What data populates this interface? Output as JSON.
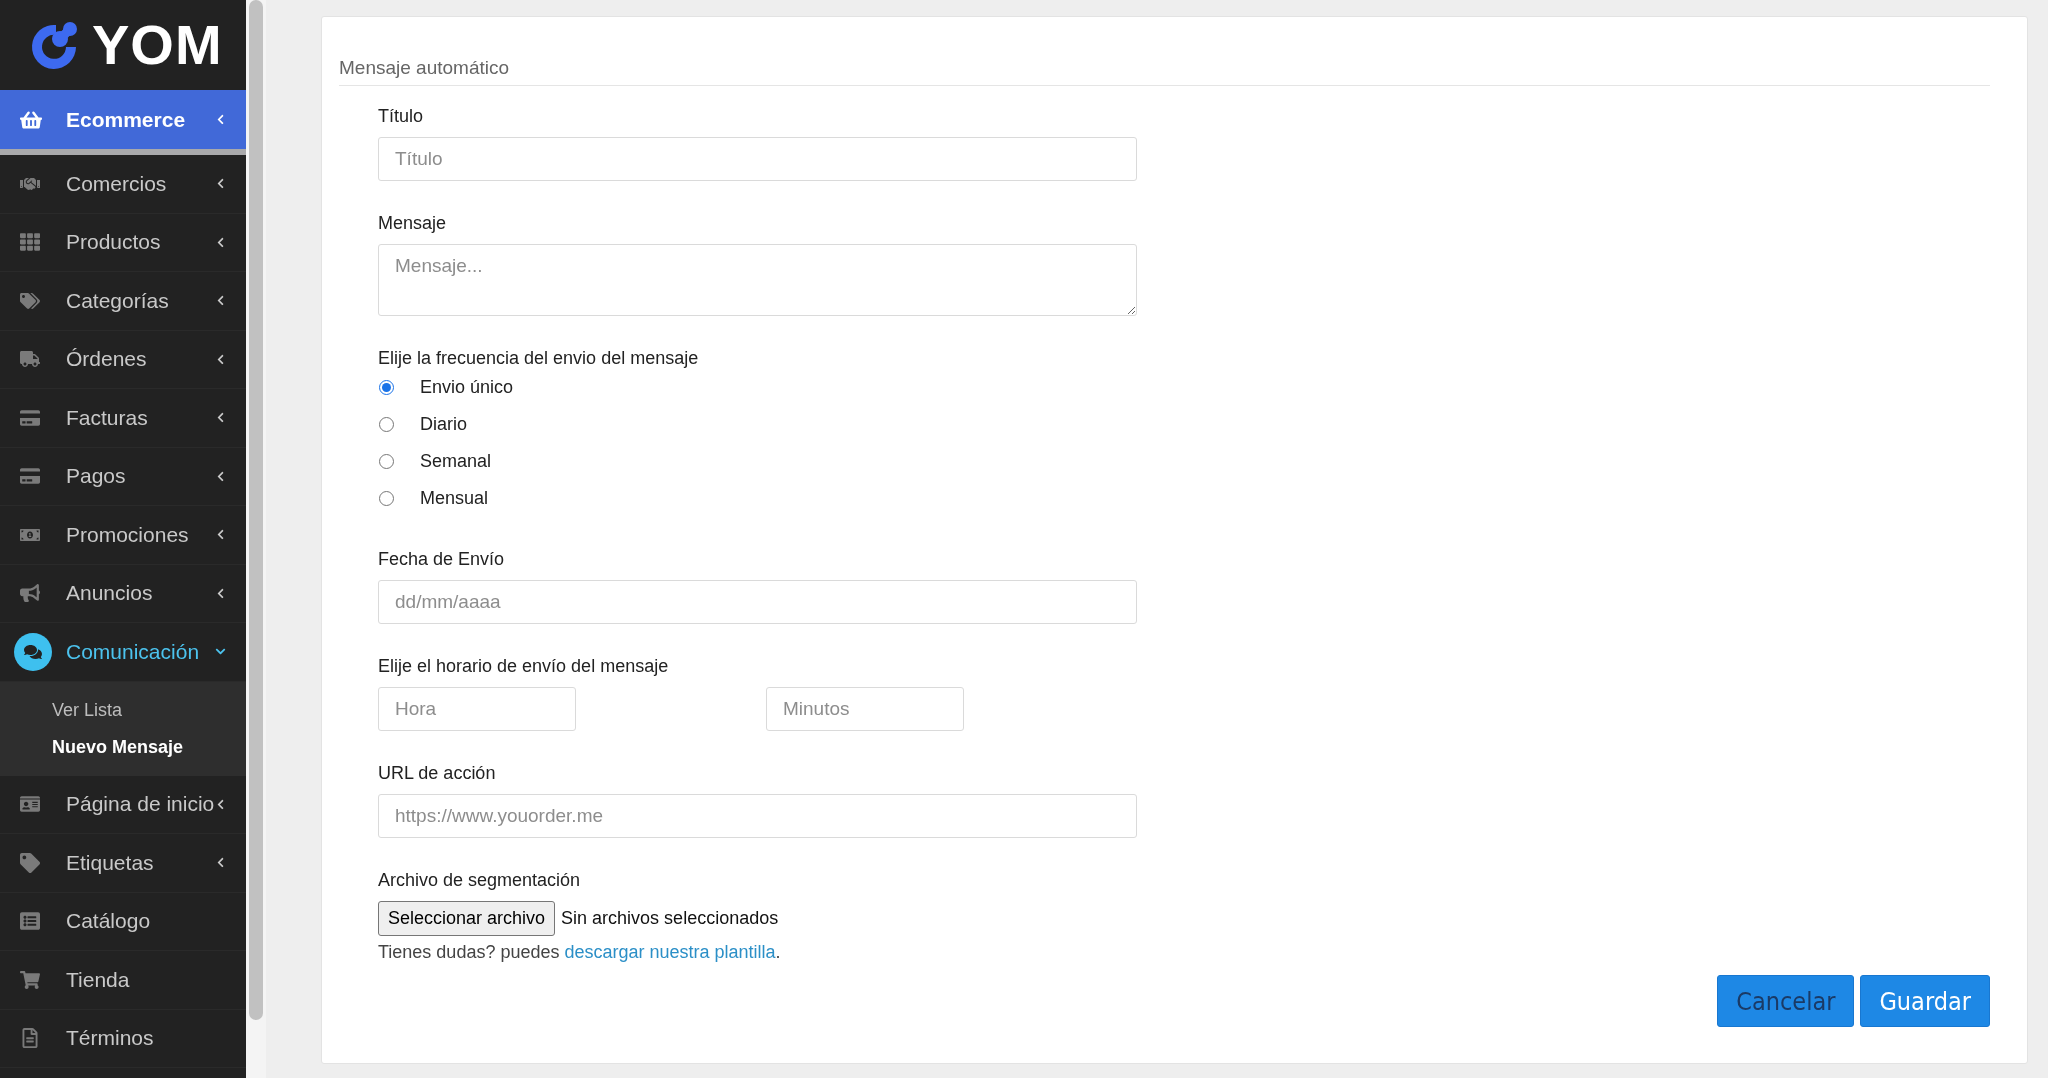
{
  "sidebar": {
    "logo": "YOM",
    "header": {
      "label": "Ecommerce",
      "selected": true,
      "expandable": true
    },
    "items": [
      {
        "label": "Comercios",
        "selected": false,
        "expandable": true,
        "expanded": false
      },
      {
        "label": "Productos",
        "selected": false,
        "expandable": true,
        "expanded": false
      },
      {
        "label": "Categorías",
        "selected": false,
        "expandable": true,
        "expanded": false
      },
      {
        "label": "Órdenes",
        "selected": false,
        "expandable": true,
        "expanded": false
      },
      {
        "label": "Facturas",
        "selected": false,
        "expandable": true,
        "expanded": false
      },
      {
        "label": "Pagos",
        "selected": false,
        "expandable": true,
        "expanded": false
      },
      {
        "label": "Promociones",
        "selected": false,
        "expandable": true,
        "expanded": false
      },
      {
        "label": "Anuncios",
        "selected": false,
        "expandable": true,
        "expanded": false
      },
      {
        "label": "Comunicación",
        "selected": true,
        "expandable": true,
        "expanded": true,
        "children": [
          {
            "label": "Ver Lista",
            "selected": false
          },
          {
            "label": "Nuevo Mensaje",
            "selected": true
          }
        ]
      },
      {
        "label": "Página de inicio",
        "selected": false,
        "expandable": true,
        "expanded": false
      },
      {
        "label": "Etiquetas",
        "selected": false,
        "expandable": true,
        "expanded": false
      },
      {
        "label": "Catálogo",
        "selected": false,
        "expandable": false,
        "expanded": false
      },
      {
        "label": "Tienda",
        "selected": false,
        "expandable": false,
        "expanded": false
      },
      {
        "label": "Términos",
        "selected": false,
        "expandable": false,
        "expanded": false
      }
    ]
  },
  "form": {
    "title": "Mensaje automático",
    "fields": [
      {
        "kind": "text",
        "label": "Título",
        "placeholder": "Título"
      },
      {
        "kind": "textarea",
        "label": "Mensaje",
        "placeholder": "Mensaje..."
      },
      {
        "kind": "radio",
        "label": "Elije la frecuencia del envio del mensaje",
        "options": [
          {
            "label": "Envio único",
            "selected": true
          },
          {
            "label": "Diario",
            "selected": false
          },
          {
            "label": "Semanal",
            "selected": false
          },
          {
            "label": "Mensual",
            "selected": false
          }
        ]
      },
      {
        "kind": "text",
        "label": "Fecha de Envío",
        "placeholder": "dd/mm/aaaa"
      },
      {
        "kind": "pair",
        "label": "Elije el horario de envío del mensaje",
        "inputs": [
          {
            "placeholder": "Hora"
          },
          {
            "placeholder": "Minutos"
          }
        ]
      },
      {
        "kind": "text",
        "label": "URL de acción",
        "placeholder": "https://www.youorder.me"
      },
      {
        "kind": "file",
        "label": "Archivo de segmentación",
        "button": "Seleccionar archivo",
        "status": "Sin archivos seleccionados",
        "help": "Tienes dudas? puedes",
        "link": "descargar nuestra plantilla",
        "after": "."
      }
    ]
  },
  "buttons": [
    {
      "kind": "cancel",
      "label": "Cancelar"
    },
    {
      "kind": "save",
      "label": "Guardar"
    }
  ]
}
